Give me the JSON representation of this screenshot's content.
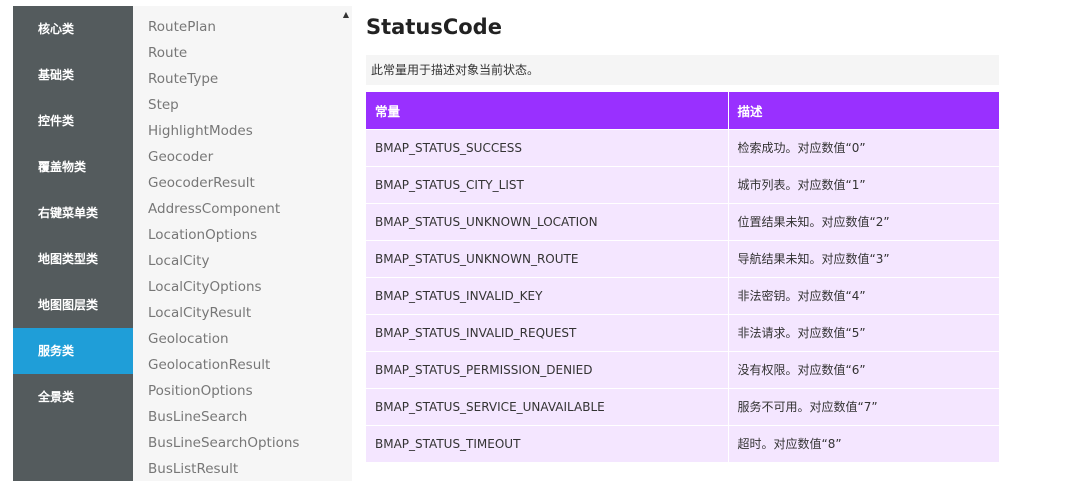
{
  "nav": {
    "categories": [
      {
        "label": "核心类",
        "active": false
      },
      {
        "label": "基础类",
        "active": false
      },
      {
        "label": "控件类",
        "active": false
      },
      {
        "label": "覆盖物类",
        "active": false
      },
      {
        "label": "右键菜单类",
        "active": false
      },
      {
        "label": "地图类型类",
        "active": false
      },
      {
        "label": "地图图层类",
        "active": false
      },
      {
        "label": "服务类",
        "active": true
      },
      {
        "label": "全景类",
        "active": false
      }
    ],
    "active_color": "#1f9ed8"
  },
  "class_list": {
    "scroll_icon": "triangle-up",
    "items": [
      "RoutePlan",
      "Route",
      "RouteType",
      "Step",
      "HighlightModes",
      "Geocoder",
      "GeocoderResult",
      "AddressComponent",
      "LocationOptions",
      "LocalCity",
      "LocalCityOptions",
      "LocalCityResult",
      "Geolocation",
      "GeolocationResult",
      "PositionOptions",
      "BusLineSearch",
      "BusLineSearchOptions",
      "BusListResult"
    ]
  },
  "content": {
    "title": "StatusCode",
    "description": "此常量用于描述对象当前状态。",
    "header_color": "#9930ff",
    "table": {
      "headers": [
        "常量",
        "描述"
      ],
      "rows": [
        [
          "BMAP_STATUS_SUCCESS",
          "检索成功。对应数值“0”"
        ],
        [
          "BMAP_STATUS_CITY_LIST",
          "城市列表。对应数值“1”"
        ],
        [
          "BMAP_STATUS_UNKNOWN_LOCATION",
          "位置结果未知。对应数值“2”"
        ],
        [
          "BMAP_STATUS_UNKNOWN_ROUTE",
          "导航结果未知。对应数值“3”"
        ],
        [
          "BMAP_STATUS_INVALID_KEY",
          "非法密钥。对应数值“4”"
        ],
        [
          "BMAP_STATUS_INVALID_REQUEST",
          "非法请求。对应数值“5”"
        ],
        [
          "BMAP_STATUS_PERMISSION_DENIED",
          "没有权限。对应数值“6”"
        ],
        [
          "BMAP_STATUS_SERVICE_UNAVAILABLE",
          "服务不可用。对应数值“7”"
        ],
        [
          "BMAP_STATUS_TIMEOUT",
          "超时。对应数值“8”"
        ]
      ]
    }
  }
}
